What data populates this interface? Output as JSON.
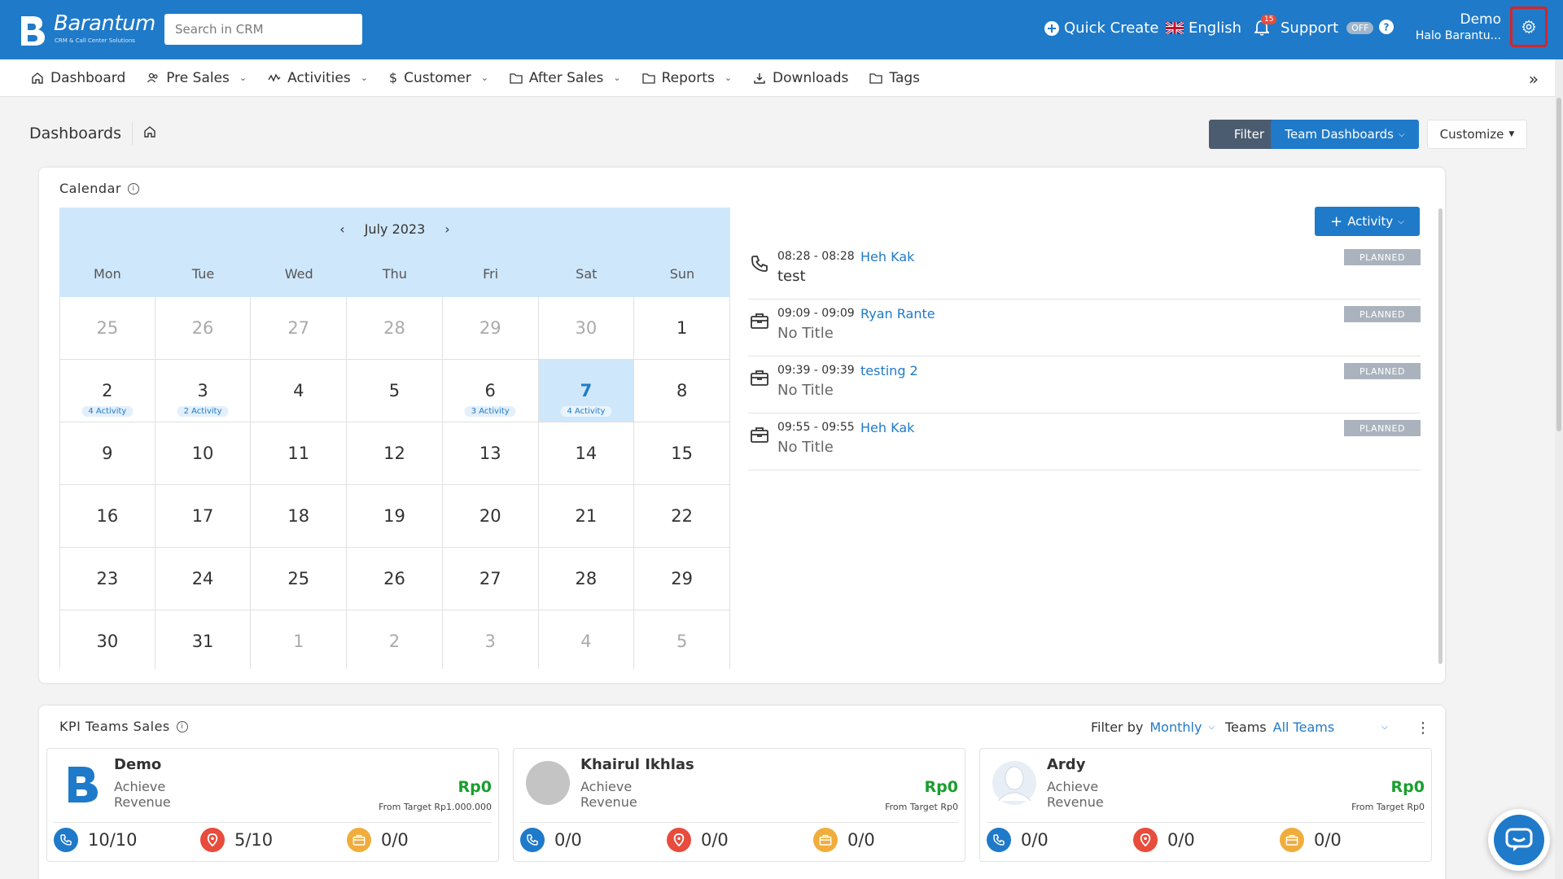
{
  "brand": {
    "name": "Barantum",
    "tagline": "CRM & Call Center Solutions"
  },
  "search": {
    "placeholder": "Search in CRM"
  },
  "topbar": {
    "quick_create": "Quick Create",
    "language": "English",
    "notification_count": "15",
    "support_label": "Support",
    "support_toggle": "OFF",
    "user_name": "Demo",
    "user_company": "Halo Barantu..."
  },
  "nav": {
    "items": [
      {
        "label": "Dashboard",
        "icon": "home-icon",
        "has_dropdown": false
      },
      {
        "label": "Pre Sales",
        "icon": "users-icon",
        "has_dropdown": true
      },
      {
        "label": "Activities",
        "icon": "activity-icon",
        "has_dropdown": true
      },
      {
        "label": "Customer",
        "icon": "dollar-icon",
        "has_dropdown": true
      },
      {
        "label": "After Sales",
        "icon": "folder-icon",
        "has_dropdown": true
      },
      {
        "label": "Reports",
        "icon": "folder-icon",
        "has_dropdown": true
      },
      {
        "label": "Downloads",
        "icon": "download-icon",
        "has_dropdown": false
      },
      {
        "label": "Tags",
        "icon": "folder-icon",
        "has_dropdown": false
      }
    ]
  },
  "page": {
    "title": "Dashboards",
    "filter_label": "Filter",
    "team_dashboards_label": "Team Dashboards",
    "customize_label": "Customize"
  },
  "calendar": {
    "title": "Calendar",
    "month_label": "July 2023",
    "weekdays": [
      "Mon",
      "Tue",
      "Wed",
      "Thu",
      "Fri",
      "Sat",
      "Sun"
    ],
    "days": [
      {
        "num": "25",
        "muted": true
      },
      {
        "num": "26",
        "muted": true
      },
      {
        "num": "27",
        "muted": true
      },
      {
        "num": "28",
        "muted": true
      },
      {
        "num": "29",
        "muted": true
      },
      {
        "num": "30",
        "muted": true
      },
      {
        "num": "1"
      },
      {
        "num": "2",
        "activity": "4 Activity"
      },
      {
        "num": "3",
        "activity": "2 Activity"
      },
      {
        "num": "4"
      },
      {
        "num": "5"
      },
      {
        "num": "6",
        "activity": "3 Activity"
      },
      {
        "num": "7",
        "activity": "4 Activity",
        "today": true
      },
      {
        "num": "8"
      },
      {
        "num": "9"
      },
      {
        "num": "10"
      },
      {
        "num": "11"
      },
      {
        "num": "12"
      },
      {
        "num": "13"
      },
      {
        "num": "14"
      },
      {
        "num": "15"
      },
      {
        "num": "16"
      },
      {
        "num": "17"
      },
      {
        "num": "18"
      },
      {
        "num": "19"
      },
      {
        "num": "20"
      },
      {
        "num": "21"
      },
      {
        "num": "22"
      },
      {
        "num": "23"
      },
      {
        "num": "24"
      },
      {
        "num": "25"
      },
      {
        "num": "26"
      },
      {
        "num": "27"
      },
      {
        "num": "28"
      },
      {
        "num": "29"
      },
      {
        "num": "30"
      },
      {
        "num": "31"
      },
      {
        "num": "1",
        "muted": true
      },
      {
        "num": "2",
        "muted": true
      },
      {
        "num": "3",
        "muted": true
      },
      {
        "num": "4",
        "muted": true
      },
      {
        "num": "5",
        "muted": true
      }
    ],
    "add_activity_label": "Activity",
    "activities": [
      {
        "type": "call",
        "time": "08:28 - 08:28",
        "name": "Heh Kak",
        "title": "test",
        "status": "PLANNED",
        "muted": false
      },
      {
        "type": "meeting",
        "time": "09:09 - 09:09",
        "name": "Ryan Rante",
        "title": "No Title",
        "status": "PLANNED",
        "muted": true
      },
      {
        "type": "meeting",
        "time": "09:39 - 09:39",
        "name": "testing 2",
        "title": "No Title",
        "status": "PLANNED",
        "muted": true
      },
      {
        "type": "meeting",
        "time": "09:55 - 09:55",
        "name": "Heh Kak",
        "title": "No Title",
        "status": "PLANNED",
        "muted": true
      }
    ]
  },
  "kpi": {
    "title": "KPI Teams Sales",
    "filter_by_label": "Filter by",
    "filter_by_value": "Monthly",
    "teams_label": "Teams",
    "teams_value": "All Teams",
    "members": [
      {
        "name": "Demo",
        "avatar": "barantum-logo",
        "achieve": "Achieve",
        "revenue": "Revenue",
        "amount": "Rp0",
        "target": "From Target Rp1.000.000",
        "calls": "10/10",
        "visits": "5/10",
        "meetings": "0/0"
      },
      {
        "name": "Khairul Ikhlas",
        "avatar": "grey-circle",
        "achieve": "Achieve",
        "revenue": "Revenue",
        "amount": "Rp0",
        "target": "From Target Rp0",
        "calls": "0/0",
        "visits": "0/0",
        "meetings": "0/0"
      },
      {
        "name": "Ardy",
        "avatar": "person-placeholder",
        "achieve": "Achieve",
        "revenue": "Revenue",
        "amount": "Rp0",
        "target": "From Target Rp0",
        "calls": "0/0",
        "visits": "0/0",
        "meetings": "0/0"
      }
    ]
  },
  "colors": {
    "primary": "#1f7ac9",
    "dark_button": "#4c5c70",
    "success": "#1a9e2e",
    "phone": "#1f7ac9",
    "visit": "#e74c3c",
    "meeting": "#f0ad3c"
  }
}
